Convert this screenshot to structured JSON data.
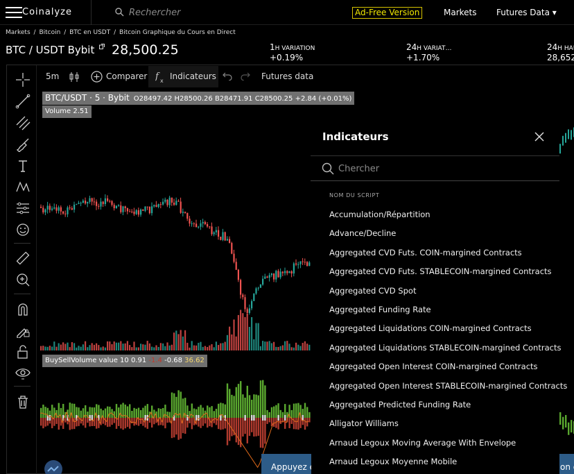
{
  "nav": {
    "brand": "Coinalyze",
    "search_placeholder": "Rechercher",
    "adfree": "Ad-Free Version",
    "markets": "Markets",
    "futures": "Futures Data ▾"
  },
  "breadcrumb": [
    "Markets",
    "/",
    "Bitcoin",
    "/",
    "BTC en USDT",
    "/",
    "Bitcoin Graphique du Cours en Direct"
  ],
  "ticker": {
    "symbol": "BTC / USDT Bybit",
    "price": "28,500.25",
    "stats": [
      {
        "num": "1",
        "label": "H VARIATION",
        "value": "+0.19%"
      },
      {
        "num": "24",
        "label": "H VARIAT…",
        "value": "+1.70%"
      },
      {
        "num": "24",
        "label": "H HAU",
        "value": "28,652"
      }
    ]
  },
  "toolbar": {
    "interval": "5m",
    "compare": "Comparer",
    "indicators": "Indicateurs",
    "futures_data": "Futures data"
  },
  "legend": {
    "title": "BTC/USDT · 5 · Bybit",
    "ohlc": "O28497.42 H28500.26 B28471.91 C28500.25 +2.84 (+0.01%)",
    "volume": "Volume  2.51",
    "bsv_label": "BuySellVolume value 10  0.91",
    "bsv_red": "-1.4",
    "bsv_mid": "-0.68",
    "bsv_yellow": "36.62"
  },
  "panel": {
    "title": "Indicateurs",
    "search_placeholder": "Chercher",
    "col_header": "NOM DU SCRIPT",
    "items": [
      "Accumulation/Répartition",
      "Advance/Decline",
      "Aggregated CVD Futs. COIN-margined Contracts",
      "Aggregated CVD Futs. STABLECOIN-margined Contracts",
      "Aggregated CVD Spot",
      "Aggregated Funding Rate",
      "Aggregated Liquidations COIN-margined Contracts",
      "Aggregated Liquidations STABLECOIN-margined Contracts",
      "Aggregated Open Interest COIN-margined Contracts",
      "Aggregated Open Interest STABLECOIN-margined Contracts",
      "Aggregated Predicted Funding Rate",
      "Alligator Williams",
      "Arnaud Legoux Moving Average With Envelope",
      "Arnaud Legoux Moyenne Mobile"
    ]
  },
  "toast": {
    "left": "Appuyez e",
    "right": "on d"
  },
  "colors": {
    "up": "#26a69a",
    "down": "#ef5350",
    "accent": "#f1e800",
    "toast": "#2d5c88"
  }
}
